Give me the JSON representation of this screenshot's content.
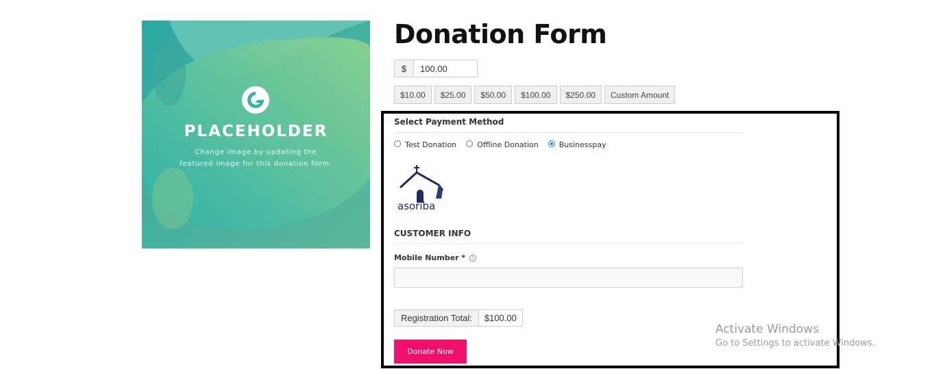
{
  "placeholder": {
    "title": "PLACEHOLDER",
    "subtitle_line1": "Change image by updating the",
    "subtitle_line2": "featured image for this donation form."
  },
  "form": {
    "title": "Donation Form",
    "currency_symbol": "$",
    "amount_value": "100.00",
    "levels": [
      "$10.00",
      "$25.00",
      "$50.00",
      "$100.00",
      "$250.00",
      "Custom Amount"
    ]
  },
  "payment": {
    "section_title": "Select Payment Method",
    "gateways": [
      {
        "label": "Test Donation",
        "selected": false
      },
      {
        "label": "Offline Donation",
        "selected": false
      },
      {
        "label": "Businesspay",
        "selected": true
      }
    ],
    "logo_text": "asoriba"
  },
  "customer": {
    "section_title": "CUSTOMER INFO",
    "mobile_label": "Mobile Number *",
    "help_icon": "question-circle-icon",
    "mobile_value": "",
    "total_label": "Registration Total:",
    "total_value": "$100.00",
    "donate_label": "Donate Now"
  },
  "watermark": {
    "line1": "Activate Windows",
    "line2": "Go to Settings to activate Windows."
  },
  "colors": {
    "donate_button": "#f0106b",
    "teal": "#2fb4a8",
    "radio_selected": "#1a73e8"
  }
}
